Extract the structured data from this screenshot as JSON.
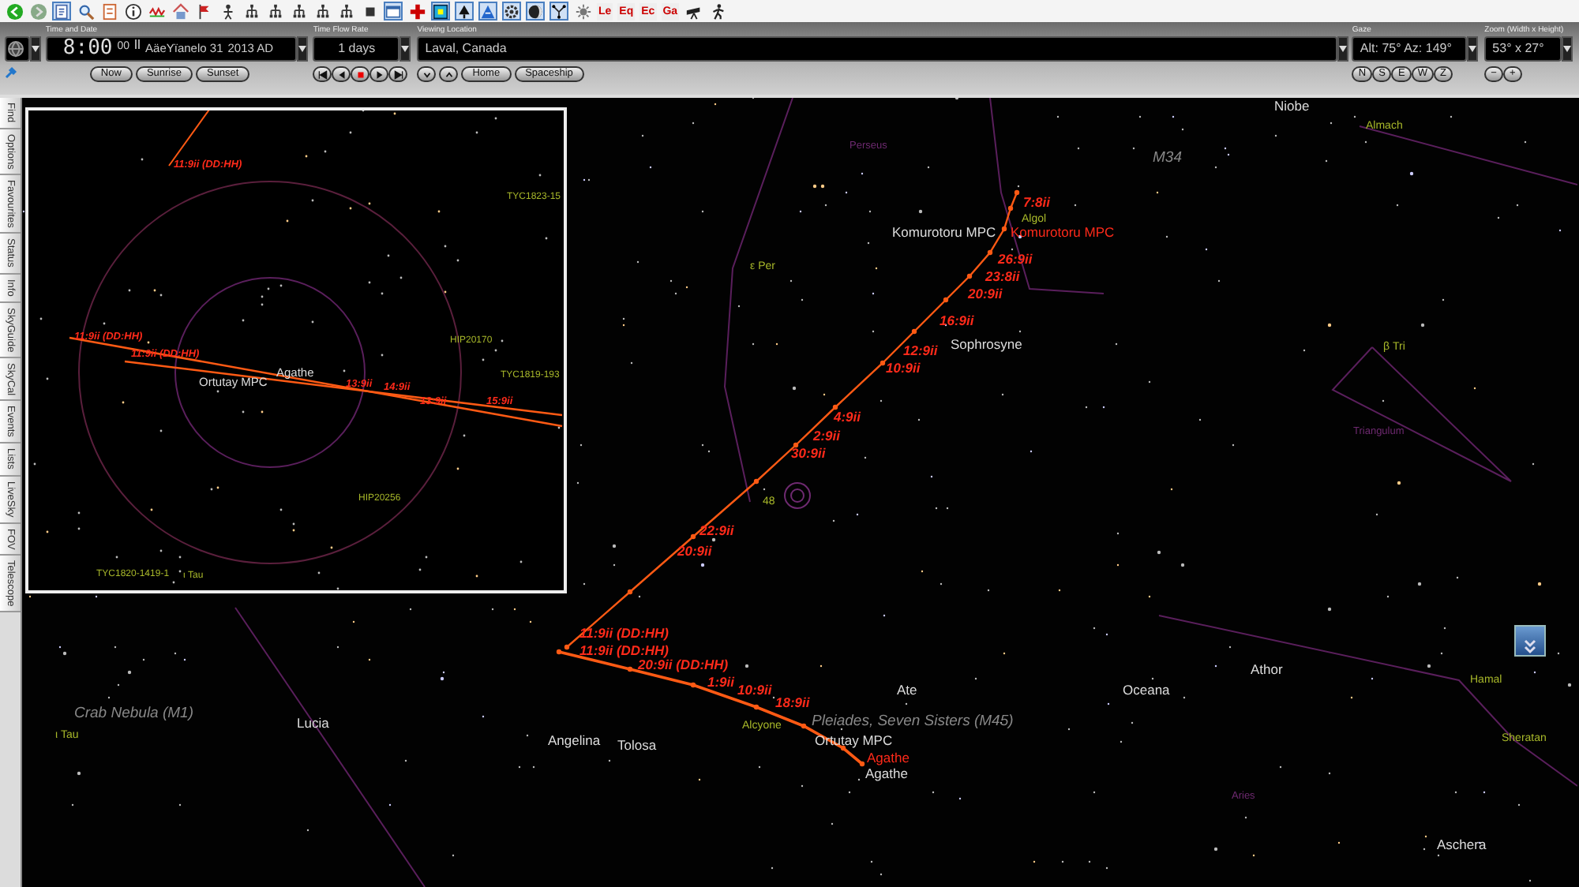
{
  "toolbar": {
    "text_buttons": [
      "Le",
      "Eq",
      "Ec",
      "Ga"
    ]
  },
  "time_and_date": {
    "label": "Time and Date",
    "time": "8:00",
    "seconds": "00",
    "date": "AäeYïanelo 31",
    "year": "2013 AD",
    "buttons": [
      "Now",
      "Sunrise",
      "Sunset"
    ]
  },
  "time_flow_rate": {
    "label": "Time Flow Rate",
    "value": "1 days"
  },
  "viewing_location": {
    "label": "Viewing Location",
    "value": "Laval, Canada",
    "buttons": [
      "Home",
      "Spaceship"
    ]
  },
  "gaze": {
    "label": "Gaze",
    "value": "Alt: 75° Az: 149°",
    "buttons": [
      "N",
      "S",
      "E",
      "W",
      "Z"
    ]
  },
  "zoom": {
    "label": "Zoom (Width x Height)",
    "value": "53° x 27°",
    "buttons": [
      "−",
      "+"
    ]
  },
  "side_tabs": [
    "Find",
    "Options",
    "Favourites",
    "Status",
    "Info",
    "SkyGuide",
    "SkyCal",
    "Events",
    "Lists",
    "LiveSky",
    "FOV",
    "Telescope"
  ],
  "sky_labels": [
    {
      "text": "Niobe",
      "kind": "object"
    },
    {
      "text": "Almach",
      "kind": "star"
    },
    {
      "text": "M34",
      "kind": "deep-sky"
    },
    {
      "text": "Perseus",
      "kind": "constellation"
    },
    {
      "text": "7:8ii",
      "kind": "path"
    },
    {
      "text": "Algol",
      "kind": "star"
    },
    {
      "text": "Komurotoru MPC",
      "kind": "object"
    },
    {
      "text": "Komurotoru MPC",
      "kind": "path-object"
    },
    {
      "text": "26:9ii",
      "kind": "path"
    },
    {
      "text": "23:8ii",
      "kind": "path"
    },
    {
      "text": "20:9ii",
      "kind": "path"
    },
    {
      "text": "16:9ii",
      "kind": "path"
    },
    {
      "text": "12:9ii",
      "kind": "path"
    },
    {
      "text": "Sophrosyne",
      "kind": "object"
    },
    {
      "text": "10:9ii",
      "kind": "path"
    },
    {
      "text": "ε Per",
      "kind": "star"
    },
    {
      "text": "4:9ii",
      "kind": "path"
    },
    {
      "text": "2:9ii",
      "kind": "path"
    },
    {
      "text": "30:9ii",
      "kind": "path"
    },
    {
      "text": "48",
      "kind": "star"
    },
    {
      "text": "22:9ii",
      "kind": "path"
    },
    {
      "text": "20:9ii",
      "kind": "path"
    },
    {
      "text": "11:9ii (DD:HH)",
      "kind": "path"
    },
    {
      "text": "11:9ii (DD:HH)",
      "kind": "path"
    },
    {
      "text": "20:9ii (DD:HH)",
      "kind": "path"
    },
    {
      "text": "1:9ii",
      "kind": "path"
    },
    {
      "text": "10:9ii",
      "kind": "path"
    },
    {
      "text": "18:9ii",
      "kind": "path"
    },
    {
      "text": "Ate",
      "kind": "object"
    },
    {
      "text": "Oceana",
      "kind": "object"
    },
    {
      "text": "Athor",
      "kind": "object"
    },
    {
      "text": "Hamal",
      "kind": "star"
    },
    {
      "text": "Sheratan",
      "kind": "star"
    },
    {
      "text": "Alcyone",
      "kind": "star"
    },
    {
      "text": "Pleiades, Seven Sisters (M45)",
      "kind": "deep-sky"
    },
    {
      "text": "Ortutay MPC",
      "kind": "object"
    },
    {
      "text": "Agathe",
      "kind": "path-object"
    },
    {
      "text": "Agathe",
      "kind": "object"
    },
    {
      "text": "Crab Nebula (M1)",
      "kind": "deep-sky"
    },
    {
      "text": "ι Tau",
      "kind": "star"
    },
    {
      "text": "Lucia",
      "kind": "object"
    },
    {
      "text": "Angelina",
      "kind": "object"
    },
    {
      "text": "Tolosa",
      "kind": "object"
    },
    {
      "text": "β Tri",
      "kind": "star"
    },
    {
      "text": "Triangulum",
      "kind": "constellation"
    },
    {
      "text": "Aries",
      "kind": "constellation"
    },
    {
      "text": "Aschera",
      "kind": "object"
    }
  ],
  "inset_labels": [
    {
      "text": "11:9ii (DD:HH)",
      "kind": "path"
    },
    {
      "text": "TYC1823-15",
      "kind": "star"
    },
    {
      "text": "11:9ii (DD:HH)",
      "kind": "path"
    },
    {
      "text": "HIP20170",
      "kind": "star"
    },
    {
      "text": "11:9ii (DD:HH)",
      "kind": "path"
    },
    {
      "text": "Agathe",
      "kind": "object"
    },
    {
      "text": "Ortutay MPC",
      "kind": "object"
    },
    {
      "text": "TYC1819-193",
      "kind": "star"
    },
    {
      "text": "13:9ii",
      "kind": "path"
    },
    {
      "text": "14:9ii",
      "kind": "path"
    },
    {
      "text": "13:9ii",
      "kind": "path"
    },
    {
      "text": "15:9ii",
      "kind": "path"
    },
    {
      "text": "HIP20256",
      "kind": "star"
    },
    {
      "text": "TYC1820-1419-1",
      "kind": "star"
    },
    {
      "text": "ι Tau",
      "kind": "star"
    }
  ]
}
